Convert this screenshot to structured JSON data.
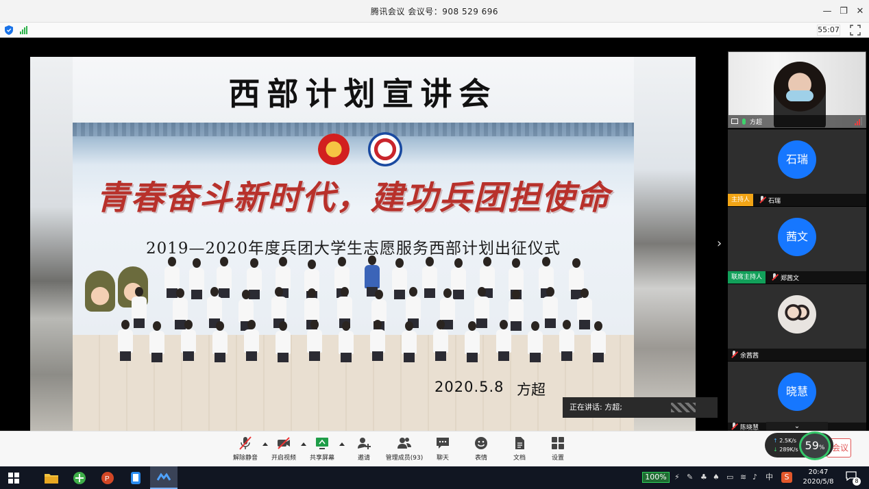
{
  "window": {
    "title": "腾讯会议 会议号：908 529 696",
    "minimize_glyph": "—",
    "restore_glyph": "❐",
    "close_glyph": "✕"
  },
  "status": {
    "timer": "55:07"
  },
  "slide": {
    "title": "西部计划宣讲会",
    "slogan": "青春奋斗新时代，建功兵团担使命",
    "subtitle": "2019—2020年度兵团大学生志愿服务西部计划出征仪式",
    "date": "2020.5.8",
    "speaker": "方超"
  },
  "speaking": {
    "label": "正在讲话: 方超;"
  },
  "expand_glyph": "›",
  "participants": {
    "video_tile": {
      "name": "方超"
    },
    "tiles": [
      {
        "avatar_text": "石瑞",
        "role": "主持人",
        "name": "石瑞",
        "role_type": "host"
      },
      {
        "avatar_text": "茜文",
        "role": "联席主持人",
        "name": "郑茜文",
        "role_type": "cohost"
      },
      {
        "avatar_text": "",
        "role": "",
        "name": "余茜茜",
        "role_type": "none"
      },
      {
        "avatar_text": "晓慧",
        "role": "",
        "name": "陈晓慧",
        "role_type": "none"
      }
    ],
    "collapse_glyph": "⌄"
  },
  "controls": {
    "unmute": "解除静音",
    "video": "开启视频",
    "share": "共享屏幕",
    "invite": "邀请",
    "members": "管理成员(93)",
    "chat": "聊天",
    "emoji": "表情",
    "docs": "文档",
    "settings": "设置"
  },
  "network": {
    "up": "2.5K/s",
    "down": "289K/s",
    "percent": "59",
    "percent_suffix": "%",
    "end_label": "会议"
  },
  "taskbar": {
    "battery": "100%",
    "ime": "中",
    "time": "20:47",
    "date": "2020/5/8",
    "notif_count": "8"
  },
  "colors": {
    "accent_blue": "#1677ff",
    "host_orange": "#f2a516",
    "cohost_green": "#12a05a",
    "slogan_red": "#b8312b"
  }
}
